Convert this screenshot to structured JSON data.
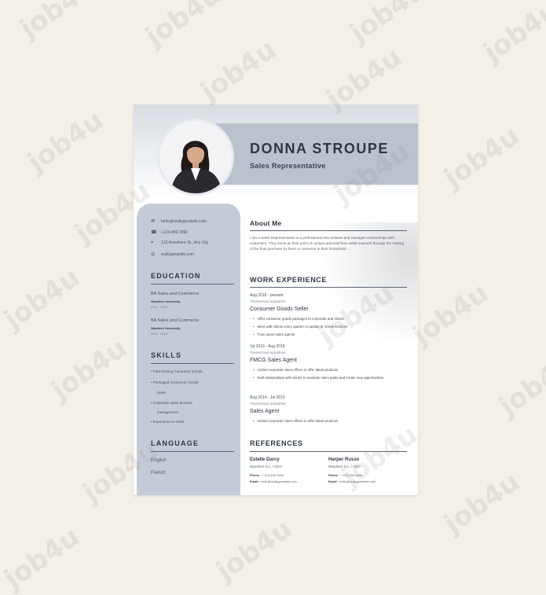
{
  "watermark": "job4u",
  "header": {
    "name": "DONNA STROUPE",
    "title": "Sales Representative"
  },
  "contact": [
    {
      "icon": "envelope-icon",
      "glyph": "✉",
      "text": "hello@reallygreatsite.com"
    },
    {
      "icon": "phone-icon",
      "glyph": "☎",
      "text": "+123-456-7890"
    },
    {
      "icon": "location-pin-icon",
      "glyph": "⌖",
      "text": "123 Anywhere St., Any City"
    },
    {
      "icon": "globe-icon",
      "glyph": "◎",
      "text": "reallygreatsite.com"
    }
  ],
  "education": {
    "heading": "EDUCATION",
    "items": [
      {
        "degree": "BA Sales and Commerce",
        "school": "Wardiere University",
        "years": "2011 - 2015"
      },
      {
        "degree": "BA Sales and Commerce",
        "school": "Wardiere University",
        "years": "2011 - 2015"
      }
    ]
  },
  "skills": {
    "heading": "SKILLS",
    "items": [
      "Fast-moving Consumer Goods",
      "Packaged Consumer Goods",
      "Sales",
      "Corporate sales account",
      "management",
      "Experience in retail"
    ]
  },
  "language": {
    "heading": "LANGUAGE",
    "items": [
      "English",
      "French"
    ]
  },
  "about": {
    "heading": "About Me",
    "text": "I am a Sales Representative & a professional who initiates and manages relationships with customers. They serve as their point of contact and lead from initial outreach through the making of the final purchase by them or someone in their household."
  },
  "work": {
    "heading": "WORK EXPERIENCE",
    "jobs": [
      {
        "dates": "Aug 2018 - present",
        "company": "Timmerman Industries",
        "role": "Consumer Goods Seller",
        "bullets": [
          "Offer consumer goods packages to corporate and clients",
          "Meet with clients every quarter to update or renew services",
          "Train junior sales agents"
        ]
      },
      {
        "dates": "Jul 2015 - Aug 2018",
        "company": "Timmerman Industries",
        "role": "FMCG Sales Agent",
        "bullets": [
          "Visited corporate client offices to offer latest products",
          "Built relationships with clients to maintain sales goals and create new opportunities"
        ]
      },
      {
        "dates": "Aug 2014 - Jul 2015",
        "company": "Timmerman Industries",
        "role": "Sales Agent",
        "bullets": [
          "Visited corporate client offices to offer latest products"
        ]
      }
    ]
  },
  "references": {
    "heading": "REFERENCES",
    "items": [
      {
        "name": "Estelle Darcy",
        "org": "Wardiere Inc. / CEO",
        "phone_label": "Phone :",
        "phone": "+123-456-7890",
        "email_label": "Email :",
        "email": "hello@reallygreatsite.com"
      },
      {
        "name": "Harper Russo",
        "org": "Wardiere Inc. / CEO",
        "phone_label": "Phone :",
        "phone": "+123-456-7890",
        "email_label": "Email :",
        "email": "hello@reallygreatsite.com"
      }
    ]
  }
}
